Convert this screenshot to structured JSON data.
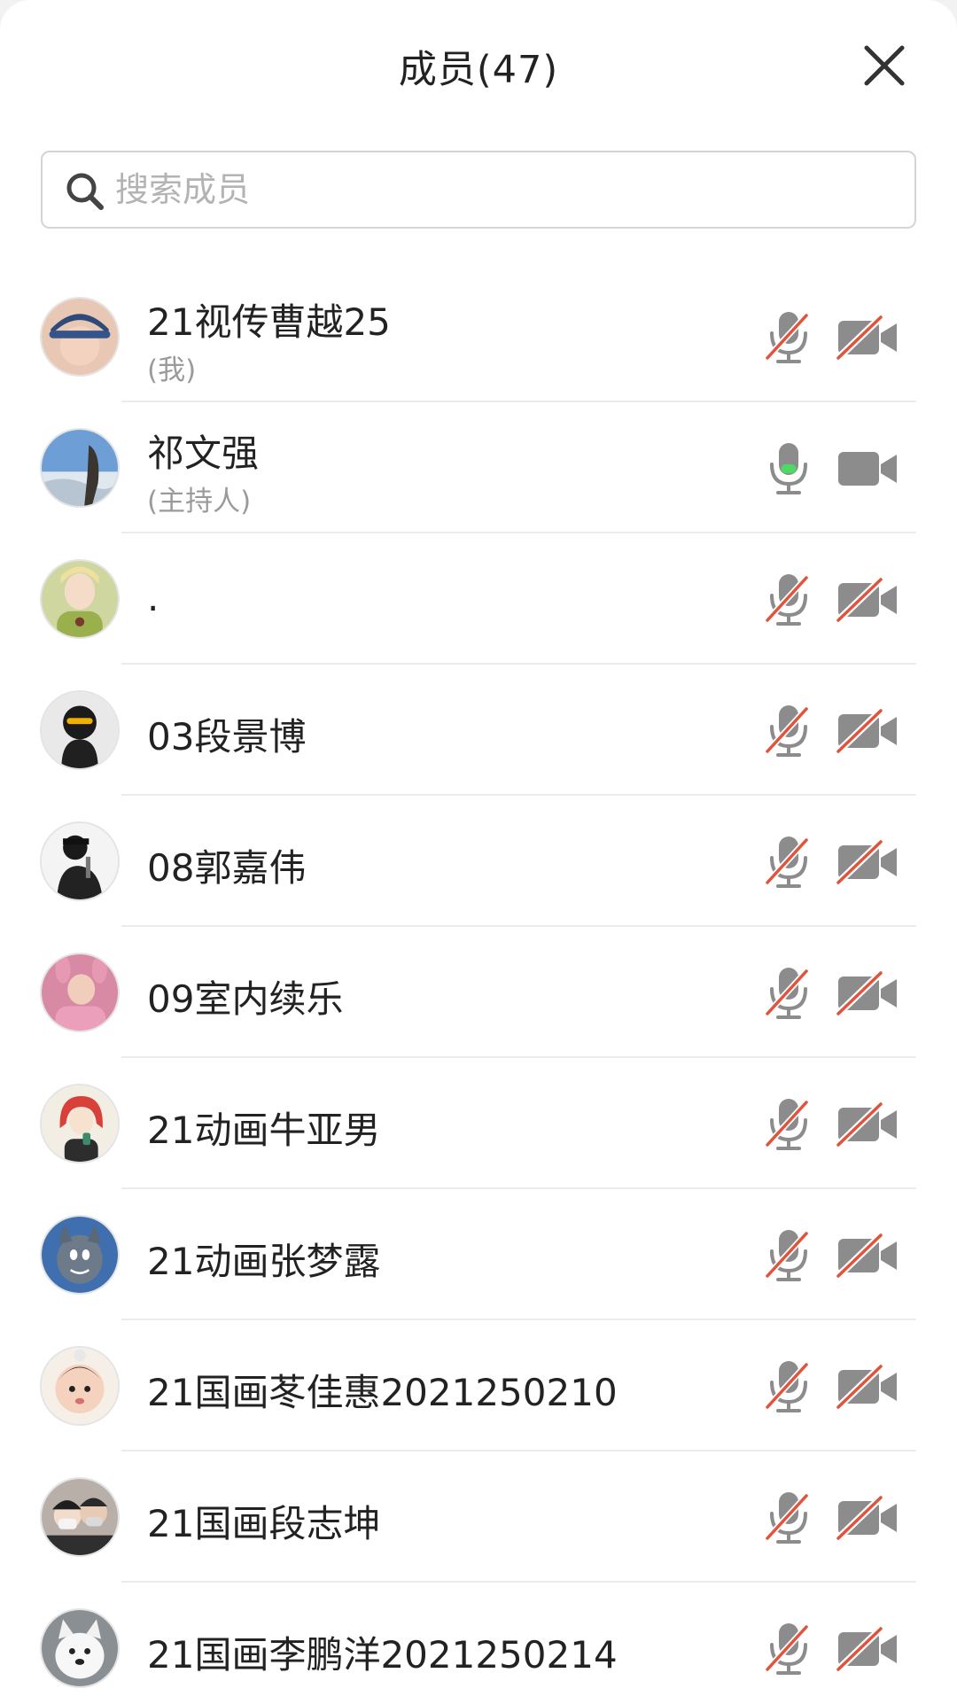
{
  "header": {
    "title": "成员(47)",
    "close_icon": "close-icon"
  },
  "search": {
    "placeholder": "搜索成员",
    "icon": "search-icon"
  },
  "colors": {
    "muted_slash": "#e0533c",
    "icon_gray": "#8c8c8c",
    "mic_active_level": "#4cd964"
  },
  "members": [
    {
      "name": "21视传曹越25",
      "role": "(我)",
      "mic": "muted",
      "camera": "off"
    },
    {
      "name": "祁文强",
      "role": "(主持人)",
      "mic": "on",
      "camera": "on"
    },
    {
      "name": ".",
      "role": "",
      "mic": "muted",
      "camera": "off"
    },
    {
      "name": "03段景博",
      "role": "",
      "mic": "muted",
      "camera": "off"
    },
    {
      "name": "08郭嘉伟",
      "role": "",
      "mic": "muted",
      "camera": "off"
    },
    {
      "name": "09室内续乐",
      "role": "",
      "mic": "muted",
      "camera": "off"
    },
    {
      "name": "21动画牛亚男",
      "role": "",
      "mic": "muted",
      "camera": "off"
    },
    {
      "name": "21动画张梦露",
      "role": "",
      "mic": "muted",
      "camera": "off"
    },
    {
      "name": "21国画苳佳惠2021250210",
      "role": "",
      "mic": "muted",
      "camera": "off"
    },
    {
      "name": "21国画段志坤",
      "role": "",
      "mic": "muted",
      "camera": "off"
    },
    {
      "name": "21国画李鹏洋2021250214",
      "role": "",
      "mic": "muted",
      "camera": "off"
    }
  ]
}
